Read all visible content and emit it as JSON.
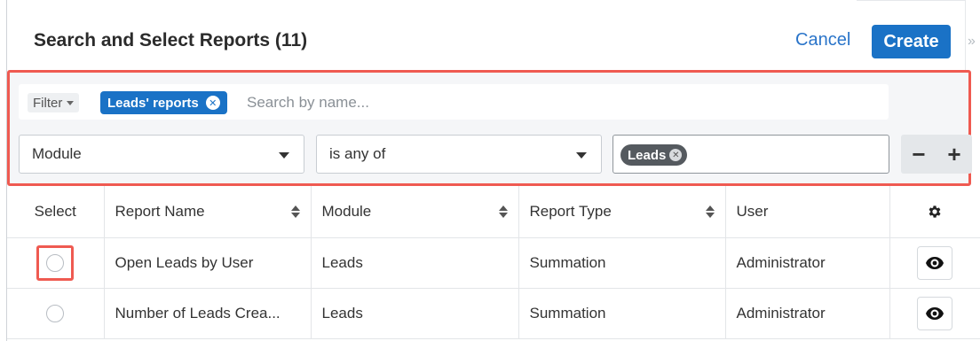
{
  "header": {
    "title": "Search and Select Reports (11)",
    "cancel_label": "Cancel",
    "create_label": "Create",
    "collapse_glyph": "»"
  },
  "filter": {
    "filter_label": "Filter",
    "active_filter": "Leads' reports",
    "search_placeholder": "Search by name...",
    "field_select": "Module",
    "operator_select": "is any of",
    "value_chip": "Leads",
    "remove_row_glyph": "−",
    "add_row_glyph": "+"
  },
  "table": {
    "columns": {
      "select": "Select",
      "report_name": "Report Name",
      "module": "Module",
      "report_type": "Report Type",
      "user": "User"
    },
    "rows": [
      {
        "report_name": "Open Leads by User",
        "module": "Leads",
        "report_type": "Summation",
        "user": "Administrator"
      },
      {
        "report_name": "Number of Leads Crea...",
        "module": "Leads",
        "report_type": "Summation",
        "user": "Administrator"
      }
    ]
  },
  "colors": {
    "accent": "#1a72c6",
    "highlight": "#ef5a51",
    "chip": "#555a5f"
  },
  "icons": [
    "caret-down-icon",
    "remove-filter-icon",
    "sort-icon",
    "gear-icon",
    "eye-icon",
    "radio-icon"
  ]
}
